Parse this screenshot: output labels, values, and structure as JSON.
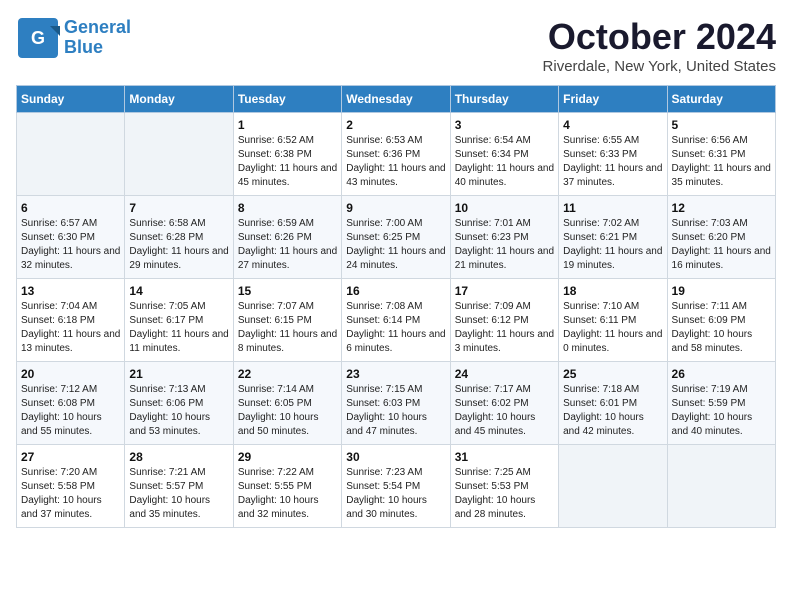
{
  "header": {
    "logo_line1": "General",
    "logo_line2": "Blue",
    "month_title": "October 2024",
    "location": "Riverdale, New York, United States"
  },
  "weekdays": [
    "Sunday",
    "Monday",
    "Tuesday",
    "Wednesday",
    "Thursday",
    "Friday",
    "Saturday"
  ],
  "weeks": [
    [
      {
        "day": "",
        "detail": ""
      },
      {
        "day": "",
        "detail": ""
      },
      {
        "day": "1",
        "detail": "Sunrise: 6:52 AM\nSunset: 6:38 PM\nDaylight: 11 hours and 45 minutes."
      },
      {
        "day": "2",
        "detail": "Sunrise: 6:53 AM\nSunset: 6:36 PM\nDaylight: 11 hours and 43 minutes."
      },
      {
        "day": "3",
        "detail": "Sunrise: 6:54 AM\nSunset: 6:34 PM\nDaylight: 11 hours and 40 minutes."
      },
      {
        "day": "4",
        "detail": "Sunrise: 6:55 AM\nSunset: 6:33 PM\nDaylight: 11 hours and 37 minutes."
      },
      {
        "day": "5",
        "detail": "Sunrise: 6:56 AM\nSunset: 6:31 PM\nDaylight: 11 hours and 35 minutes."
      }
    ],
    [
      {
        "day": "6",
        "detail": "Sunrise: 6:57 AM\nSunset: 6:30 PM\nDaylight: 11 hours and 32 minutes."
      },
      {
        "day": "7",
        "detail": "Sunrise: 6:58 AM\nSunset: 6:28 PM\nDaylight: 11 hours and 29 minutes."
      },
      {
        "day": "8",
        "detail": "Sunrise: 6:59 AM\nSunset: 6:26 PM\nDaylight: 11 hours and 27 minutes."
      },
      {
        "day": "9",
        "detail": "Sunrise: 7:00 AM\nSunset: 6:25 PM\nDaylight: 11 hours and 24 minutes."
      },
      {
        "day": "10",
        "detail": "Sunrise: 7:01 AM\nSunset: 6:23 PM\nDaylight: 11 hours and 21 minutes."
      },
      {
        "day": "11",
        "detail": "Sunrise: 7:02 AM\nSunset: 6:21 PM\nDaylight: 11 hours and 19 minutes."
      },
      {
        "day": "12",
        "detail": "Sunrise: 7:03 AM\nSunset: 6:20 PM\nDaylight: 11 hours and 16 minutes."
      }
    ],
    [
      {
        "day": "13",
        "detail": "Sunrise: 7:04 AM\nSunset: 6:18 PM\nDaylight: 11 hours and 13 minutes."
      },
      {
        "day": "14",
        "detail": "Sunrise: 7:05 AM\nSunset: 6:17 PM\nDaylight: 11 hours and 11 minutes."
      },
      {
        "day": "15",
        "detail": "Sunrise: 7:07 AM\nSunset: 6:15 PM\nDaylight: 11 hours and 8 minutes."
      },
      {
        "day": "16",
        "detail": "Sunrise: 7:08 AM\nSunset: 6:14 PM\nDaylight: 11 hours and 6 minutes."
      },
      {
        "day": "17",
        "detail": "Sunrise: 7:09 AM\nSunset: 6:12 PM\nDaylight: 11 hours and 3 minutes."
      },
      {
        "day": "18",
        "detail": "Sunrise: 7:10 AM\nSunset: 6:11 PM\nDaylight: 11 hours and 0 minutes."
      },
      {
        "day": "19",
        "detail": "Sunrise: 7:11 AM\nSunset: 6:09 PM\nDaylight: 10 hours and 58 minutes."
      }
    ],
    [
      {
        "day": "20",
        "detail": "Sunrise: 7:12 AM\nSunset: 6:08 PM\nDaylight: 10 hours and 55 minutes."
      },
      {
        "day": "21",
        "detail": "Sunrise: 7:13 AM\nSunset: 6:06 PM\nDaylight: 10 hours and 53 minutes."
      },
      {
        "day": "22",
        "detail": "Sunrise: 7:14 AM\nSunset: 6:05 PM\nDaylight: 10 hours and 50 minutes."
      },
      {
        "day": "23",
        "detail": "Sunrise: 7:15 AM\nSunset: 6:03 PM\nDaylight: 10 hours and 47 minutes."
      },
      {
        "day": "24",
        "detail": "Sunrise: 7:17 AM\nSunset: 6:02 PM\nDaylight: 10 hours and 45 minutes."
      },
      {
        "day": "25",
        "detail": "Sunrise: 7:18 AM\nSunset: 6:01 PM\nDaylight: 10 hours and 42 minutes."
      },
      {
        "day": "26",
        "detail": "Sunrise: 7:19 AM\nSunset: 5:59 PM\nDaylight: 10 hours and 40 minutes."
      }
    ],
    [
      {
        "day": "27",
        "detail": "Sunrise: 7:20 AM\nSunset: 5:58 PM\nDaylight: 10 hours and 37 minutes."
      },
      {
        "day": "28",
        "detail": "Sunrise: 7:21 AM\nSunset: 5:57 PM\nDaylight: 10 hours and 35 minutes."
      },
      {
        "day": "29",
        "detail": "Sunrise: 7:22 AM\nSunset: 5:55 PM\nDaylight: 10 hours and 32 minutes."
      },
      {
        "day": "30",
        "detail": "Sunrise: 7:23 AM\nSunset: 5:54 PM\nDaylight: 10 hours and 30 minutes."
      },
      {
        "day": "31",
        "detail": "Sunrise: 7:25 AM\nSunset: 5:53 PM\nDaylight: 10 hours and 28 minutes."
      },
      {
        "day": "",
        "detail": ""
      },
      {
        "day": "",
        "detail": ""
      }
    ]
  ]
}
